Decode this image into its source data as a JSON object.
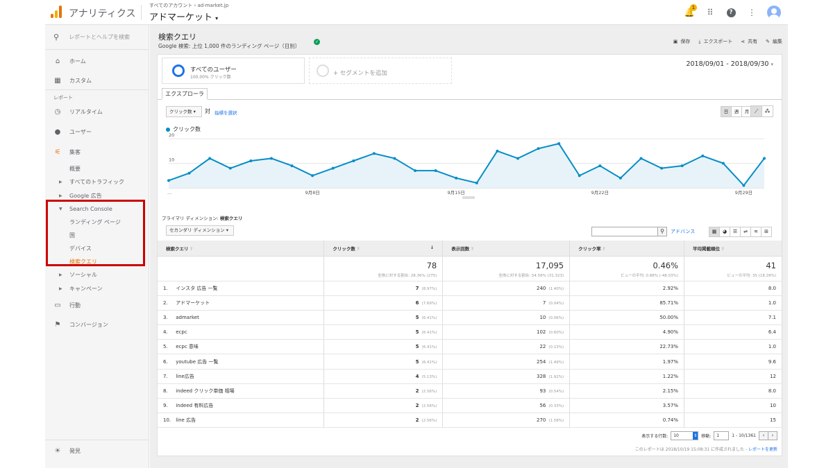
{
  "topbar": {
    "app_title": "アナリティクス",
    "crumb_root": "すべてのアカウント",
    "crumb_account": "ad-market.jp",
    "property": "アドマーケット",
    "notification_count": "1"
  },
  "sidebar": {
    "search_placeholder": "レポートとヘルプを検索",
    "home": "ホーム",
    "custom": "カスタム",
    "report_section": "レポート",
    "realtime": "リアルタイム",
    "users": "ユーザー",
    "acquisition": "集客",
    "overview": "概要",
    "all_traffic": "すべてのトラフィック",
    "google_ads": "Google 広告",
    "search_console": "Search Console",
    "landing_pages": "ランディング ページ",
    "countries": "国",
    "devices": "デバイス",
    "queries": "検索クエリ",
    "social": "ソーシャル",
    "campaigns": "キャンペーン",
    "behavior": "行動",
    "conversions": "コンバージョン",
    "discover": "発見"
  },
  "report": {
    "title": "検索クエリ",
    "subtitle": "Google 検索: 上位 1,000 件のランディング ページ（日別）",
    "actions": {
      "save": "保存",
      "export": "エクスポート",
      "share": "共有",
      "edit": "編集"
    }
  },
  "segments": {
    "all_users": "すべてのユーザー",
    "all_users_sub": "100.00% クリック数",
    "add_segment": "+ セグメントを追加"
  },
  "date_range": "2018/09/01 - 2018/09/30",
  "explorer_tab": "エクスプローラ",
  "controls": {
    "metric": "クリック数",
    "vs": "対",
    "pick_metric": "指標を選択",
    "periods": [
      "日",
      "週",
      "月"
    ]
  },
  "chart_data": {
    "type": "area",
    "series": [
      {
        "name": "クリック数",
        "values": [
          3,
          6,
          12,
          8,
          11,
          12,
          9,
          5,
          8,
          11,
          14,
          12,
          7,
          7,
          4,
          2,
          15,
          12,
          16,
          18,
          5,
          9,
          4,
          12,
          8,
          9,
          13,
          10,
          1,
          12
        ]
      }
    ],
    "x": [
      "9/1",
      "9/2",
      "9/3",
      "9/4",
      "9/5",
      "9/6",
      "9/7",
      "9/8",
      "9/9",
      "9/10",
      "9/11",
      "9/12",
      "9/13",
      "9/14",
      "9/15",
      "9/16",
      "9/17",
      "9/18",
      "9/19",
      "9/20",
      "9/21",
      "9/22",
      "9/23",
      "9/24",
      "9/25",
      "9/26",
      "9/27",
      "9/28",
      "9/29",
      "9/30"
    ],
    "x_tick_labels": [
      "...",
      "9月8日",
      "9月15日",
      "9月22日",
      "9月29日"
    ],
    "y_ticks": [
      "10",
      "20"
    ],
    "ylim": [
      0,
      22
    ],
    "color": "#058dc7"
  },
  "table": {
    "primary_dimension_label": "プライマリ ディメンション:",
    "primary_dimension_value": "検索クエリ",
    "secondary_dimension": "セカンダリ ディメンション",
    "advanced": "アドバンス",
    "headers": [
      "検索クエリ",
      "クリック数",
      "表示回数",
      "クリック率",
      "平均掲載順位"
    ],
    "totals": {
      "clicks": "78",
      "clicks_sub": "全体に対する割合: 28.36% (275)",
      "impressions": "17,095",
      "impressions_sub": "全体に対する割合: 54.58% (31,323)",
      "ctr": "0.46%",
      "ctr_sub": "ビューの平均: 0.88% (-48.03%)",
      "position": "41",
      "position_sub": "ビューの平均: 35 (18.28%)"
    },
    "rows": [
      {
        "n": "1.",
        "q": "インスタ 広告 一覧",
        "c": "7",
        "cp": "(8.97%)",
        "i": "240",
        "ip": "(1.40%)",
        "ctr": "2.92%",
        "pos": "8.0"
      },
      {
        "n": "2.",
        "q": "アドマーケット",
        "c": "6",
        "cp": "(7.69%)",
        "i": "7",
        "ip": "(0.04%)",
        "ctr": "85.71%",
        "pos": "1.0"
      },
      {
        "n": "3.",
        "q": "admarket",
        "c": "5",
        "cp": "(6.41%)",
        "i": "10",
        "ip": "(0.06%)",
        "ctr": "50.00%",
        "pos": "7.1"
      },
      {
        "n": "4.",
        "q": "ecpc",
        "c": "5",
        "cp": "(6.41%)",
        "i": "102",
        "ip": "(0.60%)",
        "ctr": "4.90%",
        "pos": "6.4"
      },
      {
        "n": "5.",
        "q": "ecpc 意味",
        "c": "5",
        "cp": "(6.41%)",
        "i": "22",
        "ip": "(0.13%)",
        "ctr": "22.73%",
        "pos": "1.0"
      },
      {
        "n": "6.",
        "q": "youtube 広告 一覧",
        "c": "5",
        "cp": "(6.41%)",
        "i": "254",
        "ip": "(1.49%)",
        "ctr": "1.97%",
        "pos": "9.6"
      },
      {
        "n": "7.",
        "q": "line広告",
        "c": "4",
        "cp": "(5.13%)",
        "i": "328",
        "ip": "(1.92%)",
        "ctr": "1.22%",
        "pos": "12"
      },
      {
        "n": "8.",
        "q": "indeed クリック単価 相場",
        "c": "2",
        "cp": "(2.56%)",
        "i": "93",
        "ip": "(0.54%)",
        "ctr": "2.15%",
        "pos": "8.0"
      },
      {
        "n": "9.",
        "q": "indeed 有料広告",
        "c": "2",
        "cp": "(2.56%)",
        "i": "56",
        "ip": "(0.33%)",
        "ctr": "3.57%",
        "pos": "10"
      },
      {
        "n": "10.",
        "q": "line 広告",
        "c": "2",
        "cp": "(2.56%)",
        "i": "270",
        "ip": "(1.58%)",
        "ctr": "0.74%",
        "pos": "15"
      }
    ]
  },
  "pager": {
    "rows_label": "表示する行数:",
    "rows_value": "10",
    "goto_label": "移動:",
    "goto_value": "1",
    "range": "1 - 10/1361"
  },
  "footer": {
    "note": "このレポートは 2018/10/19 15:08:31 に作成されました -",
    "refresh": "レポートを更新"
  }
}
